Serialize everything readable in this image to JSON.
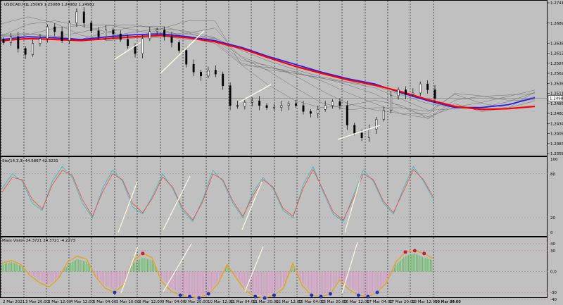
{
  "window": {
    "symbol_label": "USDCAD,H1",
    "ohlc_label": "1.25069 1.25088 1.24982 1.24982"
  },
  "chart_data": [
    {
      "type": "line",
      "panel": "price",
      "description_marks": "candlesticks with many moving averages (fan)",
      "x": [
        "2 Mar 2021",
        "3 Mar 20:00",
        "5 Mar 04:00",
        "4 Mar 12:00",
        "5 Mar 20:00",
        "8 Mar 12:00",
        "9 Mar 04:00",
        "9 Mar 20:00",
        "10 Mar 12:00",
        "11 Mar 04:00",
        "11 Mar 20:00",
        "12 Mar 12:00",
        "15 Mar 04:00",
        "15 Mar 20:00",
        "16 Mar 12:00",
        "17 Mar 04:00",
        "17 Mar 20:00",
        "18 Mar 12:00",
        "19 Mar 04:00",
        "19 Mar 20:00"
      ],
      "ylim": [
        1.2358,
        1.2741
      ],
      "yticks": [
        "1.27410",
        "1.26895",
        "1.26385",
        "1.26130",
        "1.25875",
        "1.25620",
        "1.25365",
        "1.25110",
        "1.24855",
        "1.24600",
        "1.24345",
        "1.24090",
        "1.23835",
        "1.23580"
      ],
      "current_price": "1.24982",
      "series": [
        {
          "color": "#1a1aff",
          "values": [
            1.2648,
            1.2655,
            1.2652,
            1.2648,
            1.2655,
            1.266,
            1.2662,
            1.2655,
            1.2645,
            1.2628,
            1.2605,
            1.2585,
            1.2565,
            1.2548,
            1.2535,
            1.2512,
            1.2492,
            1.2475,
            1.2475,
            1.2482,
            1.25
          ]
        },
        {
          "color": "#ff0000",
          "values": [
            1.2645,
            1.265,
            1.2648,
            1.2645,
            1.265,
            1.2655,
            1.2658,
            1.2652,
            1.2642,
            1.2625,
            1.2602,
            1.258,
            1.2562,
            1.2545,
            1.2532,
            1.2515,
            1.2495,
            1.2478,
            1.247,
            1.2472,
            1.2478
          ]
        }
      ],
      "candles_close": [
        1.264,
        1.2655,
        1.2625,
        1.261,
        1.2638,
        1.265,
        1.268,
        1.2668,
        1.2645,
        1.269,
        1.2718,
        1.269,
        1.267,
        1.2655,
        1.2672,
        1.2662,
        1.2648,
        1.2632,
        1.2612,
        1.265,
        1.2668,
        1.2672,
        1.2655,
        1.264,
        1.262,
        1.2585,
        1.2565,
        1.2555,
        1.257,
        1.256,
        1.253,
        1.248,
        1.2478,
        1.2488,
        1.2492,
        1.248,
        1.2475,
        1.2475,
        1.248,
        1.2485,
        1.248,
        1.2465,
        1.246,
        1.247,
        1.248,
        1.249,
        1.248,
        1.243,
        1.241,
        1.2398,
        1.242,
        1.2445,
        1.2468,
        1.2505,
        1.252,
        1.2508,
        1.2512,
        1.2535,
        1.252,
        1.2498
      ]
    },
    {
      "type": "line",
      "panel": "oscillator",
      "title": "Sto(14,3,3) 44.5867 42.3231",
      "ylim": [
        0,
        100
      ],
      "yticks": [
        "100",
        "80",
        "20",
        "0"
      ],
      "series": [
        {
          "color": "#20c0c0",
          "values": [
            60,
            80,
            70,
            40,
            30,
            70,
            90,
            75,
            40,
            20,
            60,
            85,
            70,
            35,
            25,
            50,
            80,
            60,
            30,
            15,
            45,
            85,
            70,
            40,
            20,
            55,
            75,
            60,
            30,
            20,
            65,
            90,
            55,
            25,
            15,
            50,
            85,
            70,
            40,
            25,
            60,
            90,
            70,
            45
          ]
        },
        {
          "color": "#ff4040",
          "values": [
            55,
            75,
            72,
            45,
            32,
            65,
            85,
            78,
            45,
            22,
            55,
            80,
            72,
            40,
            27,
            47,
            76,
            62,
            33,
            17,
            42,
            80,
            72,
            43,
            22,
            50,
            72,
            62,
            33,
            22,
            60,
            86,
            58,
            28,
            17,
            46,
            80,
            72,
            43,
            27,
            56,
            86,
            72,
            48
          ]
        }
      ]
    },
    {
      "type": "bar",
      "panel": "oscillator",
      "title": "Mass Vision 24.3721 24.3721 -4.2273",
      "ylim": [
        -40,
        40
      ],
      "yticks": [
        "40",
        "30",
        "0.0",
        "-30",
        "-40"
      ],
      "series": [
        {
          "color": "#e58acb",
          "values": [
            10,
            14,
            8,
            -4,
            -12,
            -18,
            -8,
            10,
            18,
            14,
            -6,
            -20,
            -26,
            -16,
            12,
            20,
            16,
            -10,
            -24,
            -30,
            -34,
            -38,
            -30,
            -14,
            8,
            -8,
            -22,
            -32,
            -36,
            -30,
            -20,
            8,
            -16,
            -30,
            -34,
            -28,
            -10,
            -22,
            -30,
            -34,
            -28,
            -14,
            10,
            22,
            26,
            20,
            16
          ]
        },
        {
          "color": "#e8a020",
          "values": [
            12,
            16,
            10,
            -6,
            -16,
            -22,
            -10,
            14,
            22,
            18,
            -8,
            -24,
            -30,
            -18,
            16,
            26,
            20,
            -14,
            -28,
            -34,
            -36,
            -38,
            -32,
            -18,
            10,
            -10,
            -28,
            -36,
            -38,
            -34,
            -24,
            12,
            -20,
            -34,
            -36,
            -32,
            -12,
            -26,
            -34,
            -36,
            -30,
            -16,
            14,
            28,
            30,
            26,
            18
          ]
        }
      ]
    }
  ],
  "time_axis_labels": [
    "2 Mar 2021",
    "3 Mar 20:00",
    "3 Mar 12:00",
    "4 Mar 12:00",
    "5 Mar 04:00",
    "5 Mar 20:00",
    "8 Mar 12:00",
    "9 Mar 04:00",
    "9 Mar 20:00",
    "10 Mar 12:00",
    "11 Mar 04:00",
    "11 Mar 20:00",
    "12 Mar 12:00",
    "15 Mar 04:00",
    "15 Mar 20:00",
    "16 Mar 12:00",
    "17 Mar 04:00",
    "17 Mar 20:00",
    "18 Mar 12:00",
    "19 Mar 04:00",
    "19 Mar 20:00"
  ],
  "colors": {
    "background": "#c0c0c0",
    "price_line": "#808080",
    "grid": "#000000",
    "candle": "#000000",
    "stoch_k": "#20c0c0",
    "stoch_d": "#ff4040",
    "trend": "#ffffe0"
  }
}
